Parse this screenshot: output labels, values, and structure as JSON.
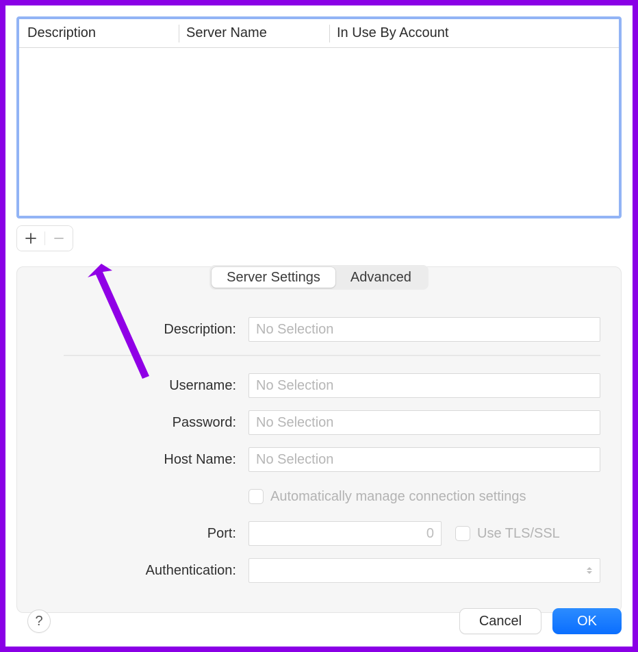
{
  "table": {
    "columns": {
      "description": "Description",
      "server_name": "Server Name",
      "in_use": "In Use By Account"
    }
  },
  "tabs": {
    "server_settings": "Server Settings",
    "advanced": "Advanced"
  },
  "fields": {
    "description_label": "Description:",
    "username_label": "Username:",
    "password_label": "Password:",
    "hostname_label": "Host Name:",
    "port_label": "Port:",
    "authentication_label": "Authentication:",
    "no_selection_placeholder": "No Selection",
    "port_placeholder": "0",
    "auto_manage_label": "Automatically manage connection settings",
    "use_tls_label": "Use TLS/SSL"
  },
  "buttons": {
    "cancel": "Cancel",
    "ok": "OK",
    "help": "?"
  }
}
